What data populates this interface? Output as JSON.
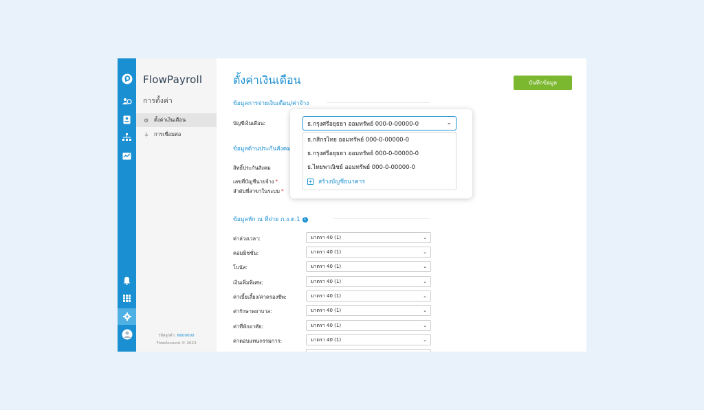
{
  "app": {
    "brand": "FlowPayroll"
  },
  "sidebar": {
    "title": "การตั้งค่า",
    "items": [
      {
        "label": "ตั้งค่าเงินเดือน",
        "icon": "gear-icon"
      },
      {
        "label": "การเชื่อมต่อ",
        "icon": "plug-icon"
      }
    ],
    "footer_code_label": "รหัสลูกค้า:",
    "footer_code": "N000000",
    "footer_copyright": "FlowAccount © 2023"
  },
  "main": {
    "title": "ตั้งค่าเงินเดือน",
    "save_label": "บันทึกข้อมูล",
    "section_payment": "ข้อมูลการจ่ายเงินเดือน/ค่าจ้าง",
    "bank_account_label": "บัญชีเงินเดือน:",
    "section_social": "ข้อมูลด้านประกันสังคม",
    "social_labels": [
      "สิทธิ์ประกันสังคม",
      "เลขที่บัญชีนายจ้าง",
      "ลำดับที่สาขาในระบบ"
    ],
    "section_tax": "ข้อมูลหัก ณ ที่จ่าย ภ.ง.ด.1",
    "tax_rows": [
      {
        "label": "ค่าล่วงเวลา:",
        "value": "มาตรา 40 (1)"
      },
      {
        "label": "คอมมิชชั่น:",
        "value": "มาตรา 40 (1)"
      },
      {
        "label": "โบนัส:",
        "value": "มาตรา 40 (1)"
      },
      {
        "label": "เงินเพิ่มพิเศษ:",
        "value": "มาตรา 40 (1)"
      },
      {
        "label": "ค่าเบี้ยเลี้ยง/ค่าครองชีพ:",
        "value": "มาตรา 40 (1)"
      },
      {
        "label": "ค่ารักษาพยาบาล:",
        "value": "มาตรา 40 (1)"
      },
      {
        "label": "ค่าที่พักอาศัย:",
        "value": "มาตรา 40 (1)"
      },
      {
        "label": "ค่าตอบแทนกรรมการ:",
        "value": "มาตรา 40 (1)"
      }
    ]
  },
  "bank_dropdown": {
    "selected": "ธ.กรุงศรีอยุธยา ออมทรัพย์ 000-0-00000-0",
    "options": [
      "ธ.กสิกรไทย ออมทรัพย์ 000-0-00000-0",
      "ธ.กรุงศรีอยุธยา ออมทรัพย์ 000-0-00000-0",
      "ธ.ไทยพาณิชย์ ออมทรัพย์ 000-0-00000-0"
    ],
    "add_label": "สร้างบัญชีธนาคาร"
  },
  "colors": {
    "accent": "#1a8fd1",
    "save": "#7cb82f",
    "rail": "#1a8fd1"
  }
}
